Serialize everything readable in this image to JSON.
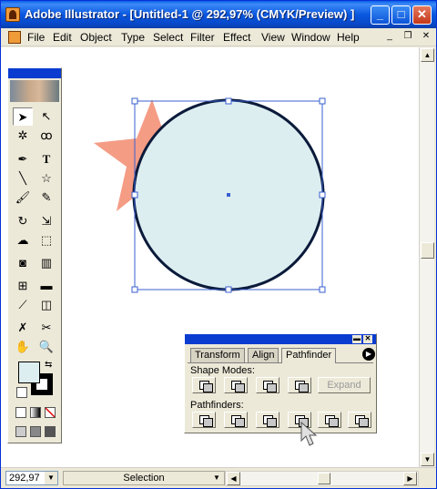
{
  "window": {
    "title": "Adobe Illustrator - [Untitled-1 @ 292,97% (CMYK/Preview) ]",
    "minimize_icon": "minimize-icon",
    "maximize_icon": "maximize-icon",
    "close_icon": "close-icon"
  },
  "menubar": {
    "items": [
      "File",
      "Edit",
      "Object",
      "Type",
      "Select",
      "Filter",
      "Effect",
      "View",
      "Window",
      "Help"
    ]
  },
  "canvas": {
    "star_color": "#f59c85",
    "circle_fill": "#ddeef1",
    "circle_stroke": "#0a1a3a",
    "selection_color": "#3a5fcf"
  },
  "toolbox": {
    "tools": [
      "selection-icon",
      "direct-selection-icon",
      "magic-wand-icon",
      "lasso-icon",
      "pen-icon",
      "type-icon",
      "line-icon",
      "star-icon",
      "paintbrush-icon",
      "pencil-icon",
      "rotate-icon",
      "scale-icon",
      "warp-icon",
      "free-transform-icon",
      "symbol-sprayer-icon",
      "graph-icon",
      "mesh-icon",
      "gradient-icon",
      "eyedropper-icon",
      "blend-icon",
      "scissors-icon",
      "hand-icon",
      "zoom-icon"
    ],
    "fill_color": "#ddeef1",
    "stroke_color": "#000000"
  },
  "pathfinder_panel": {
    "tabs": [
      "Transform",
      "Align",
      "Pathfinder"
    ],
    "active_tab": "Pathfinder",
    "shape_modes_label": "Shape Modes:",
    "expand_label": "Expand",
    "pathfinders_label": "Pathfinders:"
  },
  "statusbar": {
    "zoom": "292,97",
    "status": "Selection"
  }
}
